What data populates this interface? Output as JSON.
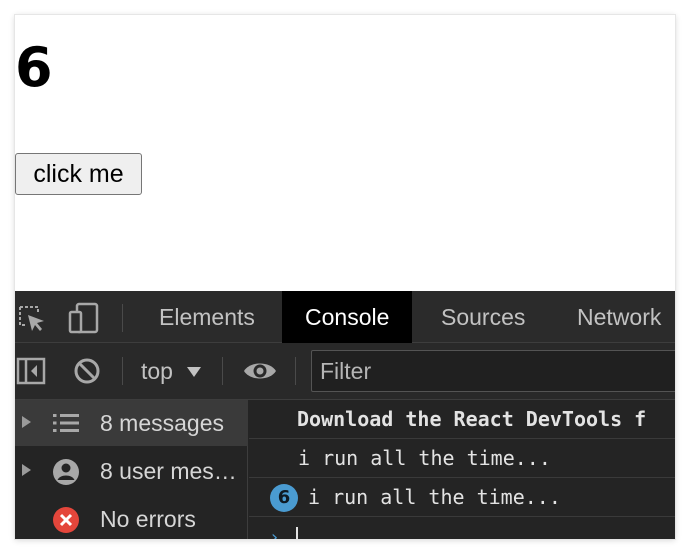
{
  "page": {
    "count": "6",
    "button_label": "click me"
  },
  "devtools": {
    "icons": {
      "inspect": "inspect-element-icon",
      "device": "device-toolbar-icon",
      "sidebar": "sidebar-toggle-icon",
      "clear": "clear-console-icon",
      "eye": "live-expression-eye-icon",
      "list": "list-icon",
      "user": "user-icon",
      "error": "error-icon",
      "chevron": "prompt-chevron-icon"
    },
    "tabs": [
      "Elements",
      "Console",
      "Sources",
      "Network"
    ],
    "active_tab": "Console",
    "toolbar": {
      "context": "top",
      "filter_placeholder": "Filter"
    },
    "sidebar": {
      "items": [
        {
          "label": "8 messages"
        },
        {
          "label": "8 user mes…"
        },
        {
          "label": "No errors"
        }
      ]
    },
    "console": {
      "lines": [
        {
          "text": "Download the React DevTools f"
        },
        {
          "text": "i run all the time..."
        },
        {
          "count": "6",
          "text": "i run all the time..."
        }
      ],
      "prompt": "›"
    },
    "colors": {
      "panel_bg": "#242424",
      "active_tab_bg": "#000000",
      "badge": "#4a9bd1",
      "error": "#e4463b"
    }
  }
}
